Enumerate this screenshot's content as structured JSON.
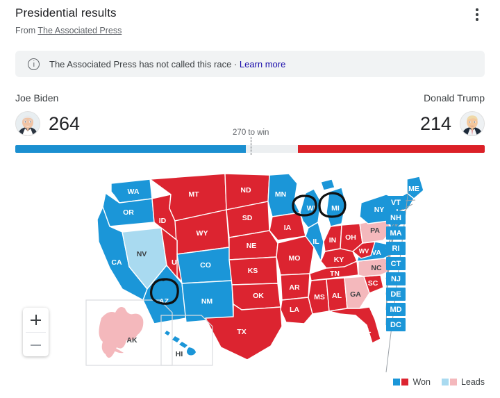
{
  "header": {
    "title": "Presidential results",
    "source_prefix": "From",
    "source_link": "The Associated Press",
    "menu_icon": "more-vert-icon"
  },
  "notice": {
    "icon": "info-icon",
    "text": "The Associated Press has not called this race · ",
    "link": "Learn more"
  },
  "candidates": {
    "left": {
      "name": "Joe Biden",
      "electoral_votes": "264",
      "color": "#1b8fd0",
      "avatar": "joe-biden-avatar"
    },
    "right": {
      "name": "Donald Trump",
      "electoral_votes": "214",
      "color": "#db2027",
      "avatar": "donald-trump-avatar"
    },
    "threshold_label": "270 to win",
    "threshold": 270,
    "bar_total": 538
  },
  "zoom_controls": {
    "zoom_in": "+",
    "zoom_out": "−"
  },
  "legend": {
    "won_label": "Won",
    "leads_label": "Leads",
    "won_blue": "#1b8fd0",
    "won_red": "#db2027",
    "leads_blue": "#a9daf0",
    "leads_red": "#f4b8bc"
  },
  "map": {
    "inset_labels": [
      "AK",
      "HI"
    ],
    "annotated_states": [
      "WI",
      "MI",
      "AZ"
    ],
    "state_boxes": [
      "VT",
      "NH",
      "MA",
      "RI",
      "CT",
      "NJ",
      "DE",
      "MD",
      "DC"
    ],
    "states": [
      {
        "code": "WA",
        "status": "won-biden"
      },
      {
        "code": "OR",
        "status": "won-biden"
      },
      {
        "code": "CA",
        "status": "won-biden"
      },
      {
        "code": "NV",
        "status": "leads-biden"
      },
      {
        "code": "ID",
        "status": "won-trump"
      },
      {
        "code": "MT",
        "status": "won-trump"
      },
      {
        "code": "WY",
        "status": "won-trump"
      },
      {
        "code": "UT",
        "status": "won-trump"
      },
      {
        "code": "AZ",
        "status": "won-biden"
      },
      {
        "code": "CO",
        "status": "won-biden"
      },
      {
        "code": "NM",
        "status": "won-biden"
      },
      {
        "code": "ND",
        "status": "won-trump"
      },
      {
        "code": "SD",
        "status": "won-trump"
      },
      {
        "code": "NE",
        "status": "won-trump"
      },
      {
        "code": "KS",
        "status": "won-trump"
      },
      {
        "code": "OK",
        "status": "won-trump"
      },
      {
        "code": "TX",
        "status": "won-trump"
      },
      {
        "code": "MN",
        "status": "won-biden"
      },
      {
        "code": "IA",
        "status": "won-trump"
      },
      {
        "code": "MO",
        "status": "won-trump"
      },
      {
        "code": "AR",
        "status": "won-trump"
      },
      {
        "code": "LA",
        "status": "won-trump"
      },
      {
        "code": "WI",
        "status": "won-biden"
      },
      {
        "code": "IL",
        "status": "won-biden"
      },
      {
        "code": "MI",
        "status": "won-biden"
      },
      {
        "code": "IN",
        "status": "won-trump"
      },
      {
        "code": "OH",
        "status": "won-trump"
      },
      {
        "code": "KY",
        "status": "won-trump"
      },
      {
        "code": "TN",
        "status": "won-trump"
      },
      {
        "code": "MS",
        "status": "won-trump"
      },
      {
        "code": "AL",
        "status": "won-trump"
      },
      {
        "code": "GA",
        "status": "leads-trump"
      },
      {
        "code": "FL",
        "status": "won-trump"
      },
      {
        "code": "SC",
        "status": "won-trump"
      },
      {
        "code": "NC",
        "status": "leads-trump"
      },
      {
        "code": "VA",
        "status": "won-biden"
      },
      {
        "code": "WV",
        "status": "won-trump"
      },
      {
        "code": "PA",
        "status": "leads-trump"
      },
      {
        "code": "NY",
        "status": "won-biden"
      },
      {
        "code": "ME",
        "status": "won-biden"
      },
      {
        "code": "AK",
        "status": "leads-trump"
      },
      {
        "code": "HI",
        "status": "won-biden"
      }
    ]
  }
}
